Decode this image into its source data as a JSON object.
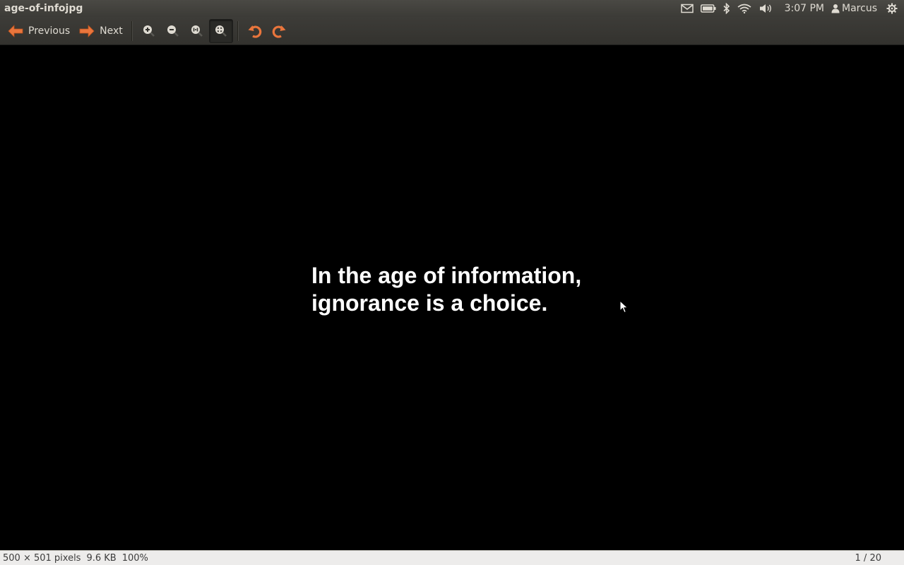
{
  "window": {
    "title": "age-of-infojpg"
  },
  "indicators": {
    "mail_icon": "envelope-icon",
    "battery_icon": "battery-icon",
    "bluetooth_icon": "bluetooth-icon",
    "wifi_icon": "wifi-icon",
    "volume_icon": "speaker-icon",
    "clock": "3:07 PM",
    "user": "Marcus",
    "session_icon": "power-gear-icon"
  },
  "toolbar": {
    "previous_label": "Previous",
    "next_label": "Next",
    "accent_color": "#e9753c",
    "buttons": [
      "zoom-in-icon",
      "zoom-out-icon",
      "normal-size-icon",
      "best-fit-icon",
      "rotate-left-icon",
      "rotate-right-icon"
    ]
  },
  "image": {
    "quote": "In the age of information,\nignorance is a choice."
  },
  "status": {
    "dimensions": "500 × 501 pixels",
    "file_size": "9.6 KB",
    "zoom": "100%",
    "position": "1 / 20"
  }
}
